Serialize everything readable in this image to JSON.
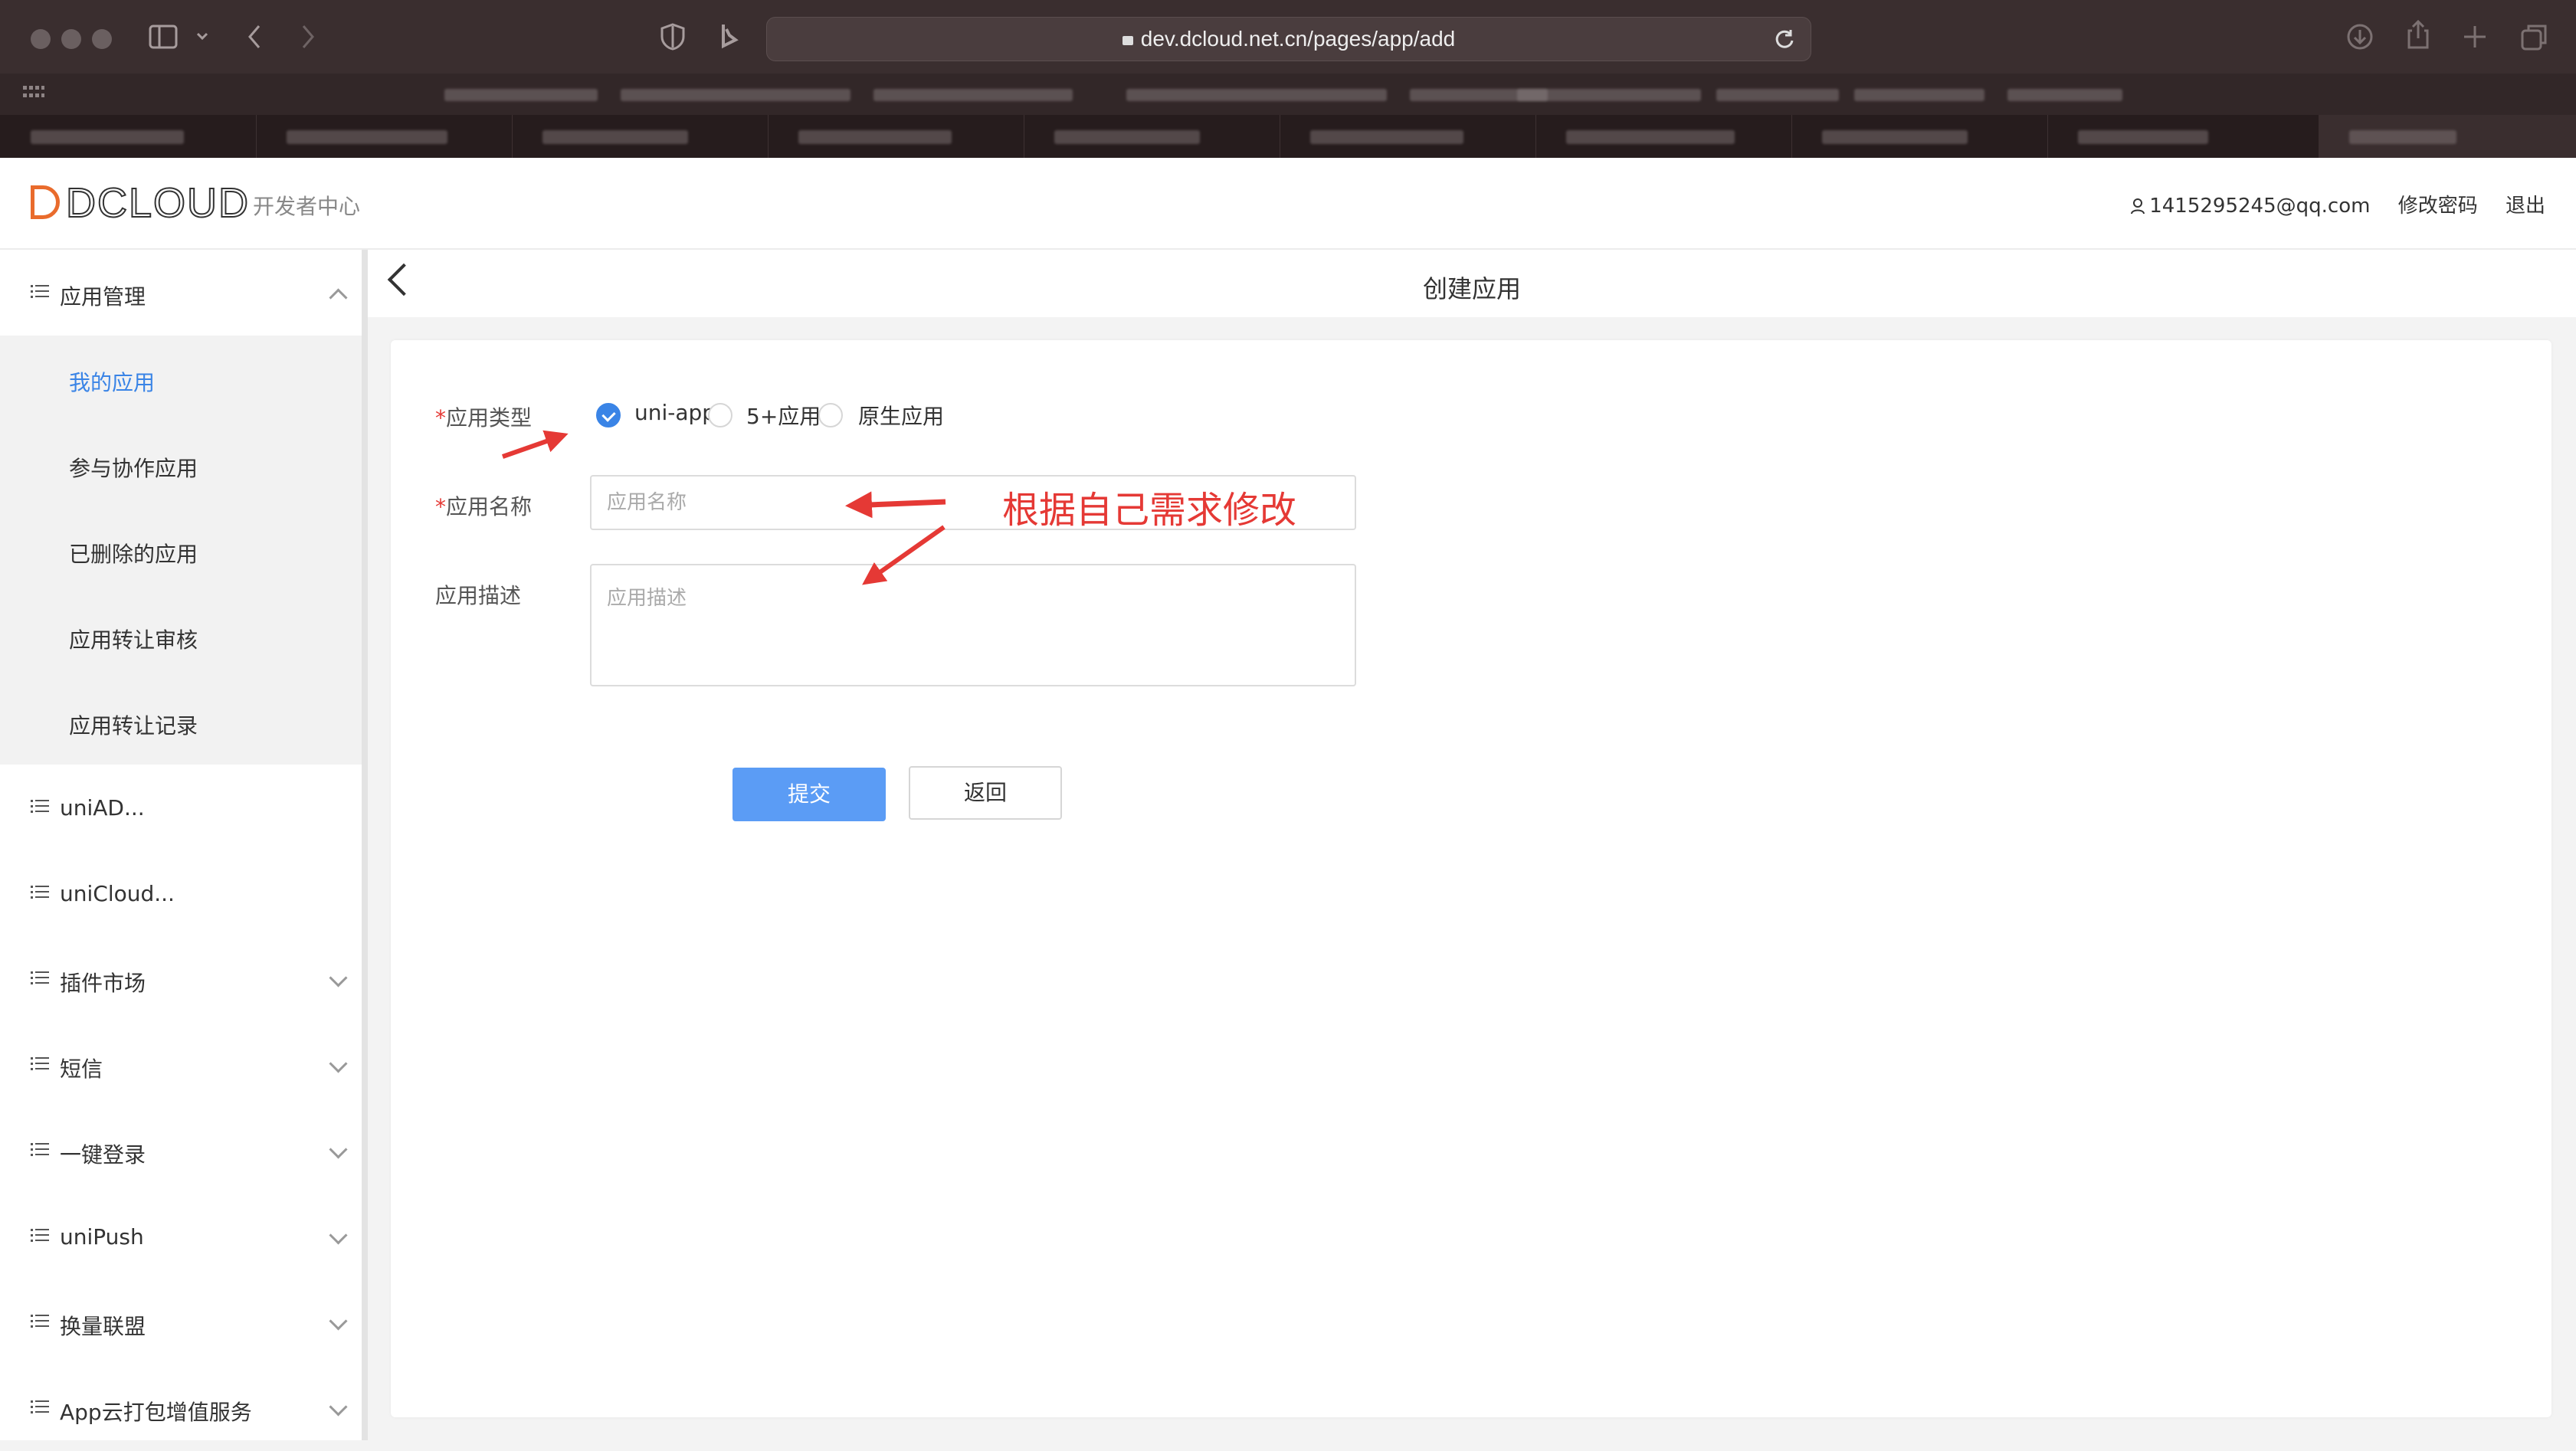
{
  "browser": {
    "url": "dev.dcloud.net.cn/pages/app/add"
  },
  "header": {
    "logo_text": "DCLOUD",
    "logo_sub": "开发者中心",
    "user_email": "1415295245@qq.com",
    "change_password": "修改密码",
    "logout": "退出"
  },
  "sidebar": {
    "groups": [
      {
        "label": "应用管理",
        "expanded": true
      },
      {
        "label": "uniAD..."
      },
      {
        "label": "uniCloud..."
      },
      {
        "label": "插件市场"
      },
      {
        "label": "短信"
      },
      {
        "label": "一键登录"
      },
      {
        "label": "uniPush"
      },
      {
        "label": "换量联盟"
      },
      {
        "label": "App云打包增值服务"
      }
    ],
    "sub_items": [
      {
        "label": "我的应用",
        "active": true
      },
      {
        "label": "参与协作应用"
      },
      {
        "label": "已删除的应用"
      },
      {
        "label": "应用转让审核"
      },
      {
        "label": "应用转让记录"
      }
    ]
  },
  "page": {
    "title": "创建应用"
  },
  "form": {
    "type_label": "应用类型",
    "type_options": [
      "uni-app",
      "5+应用",
      "原生应用"
    ],
    "selected_type": "uni-app",
    "name_label": "应用名称",
    "name_placeholder": "应用名称",
    "desc_label": "应用描述",
    "desc_placeholder": "应用描述",
    "submit_label": "提交",
    "back_label": "返回",
    "required_mark": "*"
  },
  "annotation": {
    "text": "根据自己需求修改",
    "color": "#e53935"
  },
  "colors": {
    "accent": "#3a84e6",
    "logo": "#e96b2c"
  }
}
